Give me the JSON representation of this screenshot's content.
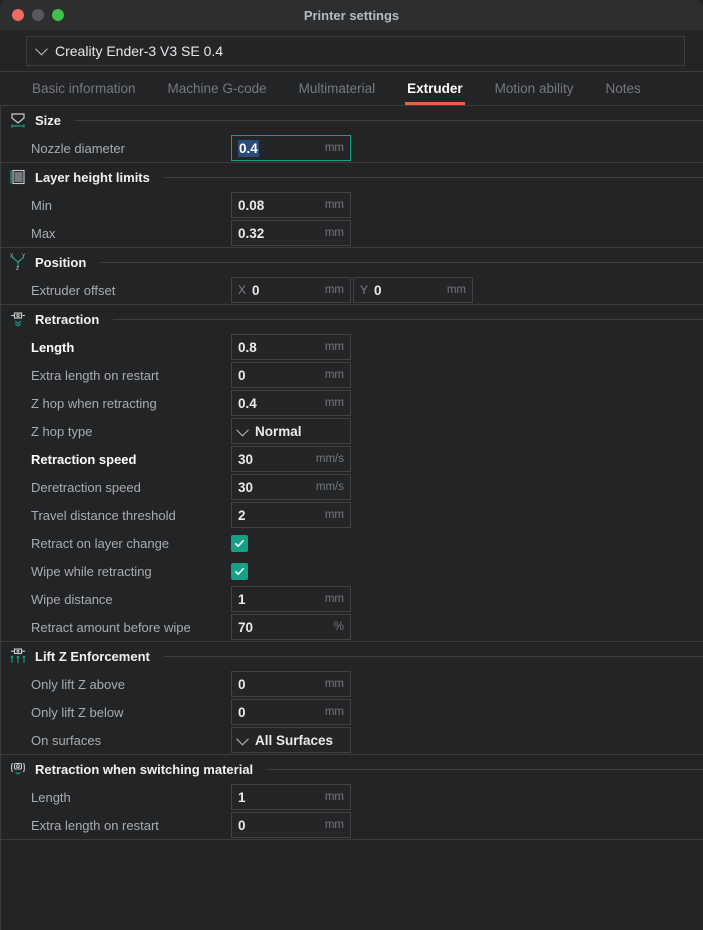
{
  "window": {
    "title": "Printer settings",
    "traffic_lights": [
      "close-red",
      "minimize-gray",
      "maximize-green"
    ]
  },
  "printer_selector": {
    "value": "Creality Ender-3 V3 SE 0.4",
    "icon": "chevron-down-icon"
  },
  "tabs": [
    {
      "label": "Basic information",
      "active": false
    },
    {
      "label": "Machine G-code",
      "active": false
    },
    {
      "label": "Multimaterial",
      "active": false
    },
    {
      "label": "Extruder",
      "active": true
    },
    {
      "label": "Motion ability",
      "active": false
    },
    {
      "label": "Notes",
      "active": false
    }
  ],
  "accent": {
    "active_tab_underline": "#e8623a",
    "focus_border": "#16a085",
    "checkbox_fill": "#16a085",
    "selection_blue": "#2a4b7c"
  },
  "groups": [
    {
      "title": "Size",
      "icon": "nozzle-size-icon",
      "fields": [
        {
          "label": "Nozzle diameter",
          "value": "0.4",
          "unit": "mm",
          "type": "text",
          "modified": false,
          "focused": true,
          "selected": true
        }
      ]
    },
    {
      "title": "Layer height limits",
      "icon": "layer-lines-icon",
      "fields": [
        {
          "label": "Min",
          "value": "0.08",
          "unit": "mm",
          "type": "text",
          "modified": false
        },
        {
          "label": "Max",
          "value": "0.32",
          "unit": "mm",
          "type": "text",
          "modified": false
        }
      ]
    },
    {
      "title": "Position",
      "icon": "xyz-axes-icon",
      "fields": [
        {
          "label": "Extruder offset",
          "type": "xy",
          "x_prefix": "X",
          "x_value": "0",
          "y_prefix": "Y",
          "y_value": "0",
          "unit": "mm",
          "modified": false
        }
      ]
    },
    {
      "title": "Retraction",
      "icon": "retraction-icon",
      "fields": [
        {
          "label": "Length",
          "value": "0.8",
          "unit": "mm",
          "type": "text",
          "modified": true
        },
        {
          "label": "Extra length on restart",
          "value": "0",
          "unit": "mm",
          "type": "text",
          "modified": false
        },
        {
          "label": "Z hop when retracting",
          "value": "0.4",
          "unit": "mm",
          "type": "text",
          "modified": false
        },
        {
          "label": "Z hop type",
          "value": "Normal",
          "unit": "",
          "type": "dropdown",
          "modified": false
        },
        {
          "label": "Retraction speed",
          "value": "30",
          "unit": "mm/s",
          "type": "text",
          "modified": true
        },
        {
          "label": "Deretraction speed",
          "value": "30",
          "unit": "mm/s",
          "type": "text",
          "modified": false
        },
        {
          "label": "Travel distance threshold",
          "value": "2",
          "unit": "mm",
          "type": "text",
          "modified": false
        },
        {
          "label": "Retract on layer change",
          "type": "checkbox",
          "checked": true,
          "modified": false
        },
        {
          "label": "Wipe while retracting",
          "type": "checkbox",
          "checked": true,
          "modified": false
        },
        {
          "label": "Wipe distance",
          "value": "1",
          "unit": "mm",
          "type": "text",
          "modified": false
        },
        {
          "label": "Retract amount before wipe",
          "value": "70",
          "unit": "%",
          "type": "text",
          "modified": false
        }
      ]
    },
    {
      "title": "Lift Z Enforcement",
      "icon": "lift-z-icon",
      "fields": [
        {
          "label": "Only lift Z above",
          "value": "0",
          "unit": "mm",
          "type": "text",
          "modified": false
        },
        {
          "label": "Only lift Z below",
          "value": "0",
          "unit": "mm",
          "type": "text",
          "modified": false
        },
        {
          "label": "On surfaces",
          "value": "All Surfaces",
          "unit": "",
          "type": "dropdown",
          "modified": false
        }
      ]
    },
    {
      "title": "Retraction when switching material",
      "icon": "material-switch-icon",
      "fields": [
        {
          "label": "Length",
          "value": "1",
          "unit": "mm",
          "type": "text",
          "modified": false
        },
        {
          "label": "Extra length on restart",
          "value": "0",
          "unit": "mm",
          "type": "text",
          "modified": false
        }
      ]
    }
  ]
}
